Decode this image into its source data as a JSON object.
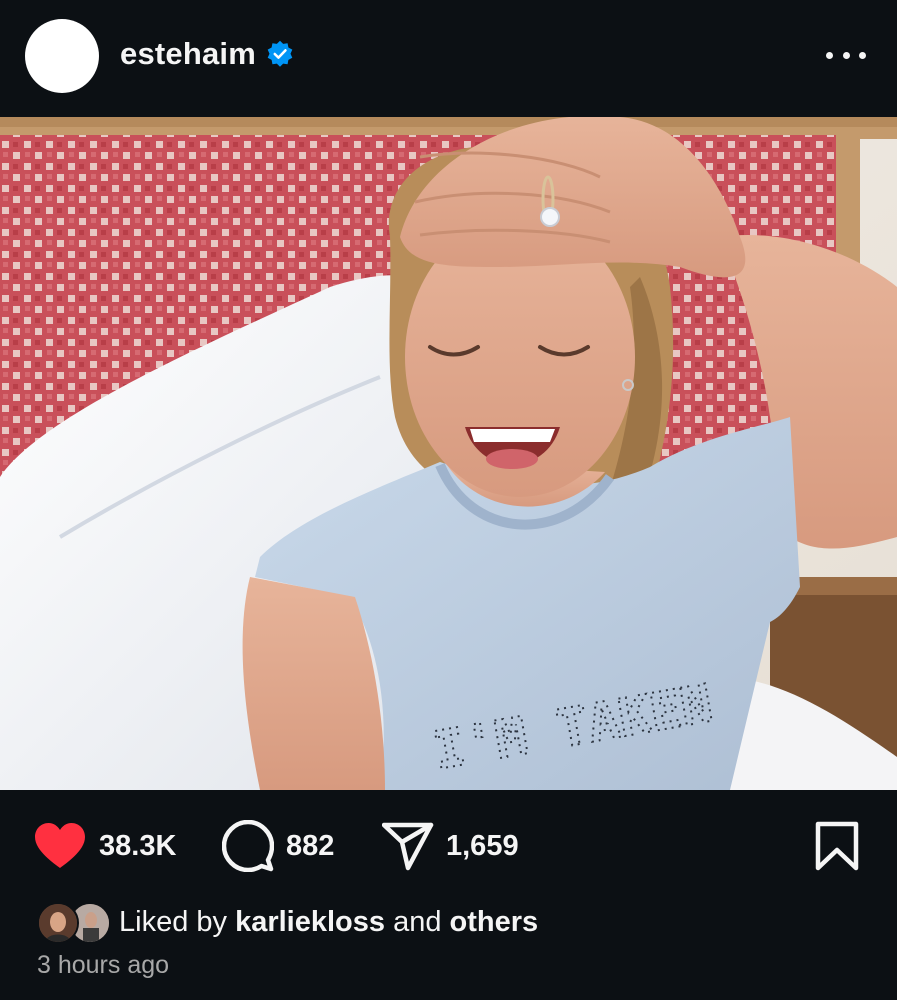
{
  "post": {
    "username": "estehaim",
    "verified": true,
    "photo_caption_shirt": "I'M TAKEN",
    "likes": "38.3K",
    "comments": "882",
    "shares": "1,659",
    "liked_by_prefix": "Liked by",
    "liked_by_user": "karliekloss",
    "liked_by_and": "and",
    "liked_by_others": "others",
    "timestamp": "3 hours ago"
  },
  "colors": {
    "background": "#0c1014",
    "like": "#ff3040",
    "verified": "#0095f6",
    "secondary_text": "#a8a8a8"
  },
  "icons": [
    "verified-badge-icon",
    "more-options-icon",
    "heart-icon",
    "comment-icon",
    "share-icon",
    "bookmark-icon"
  ]
}
